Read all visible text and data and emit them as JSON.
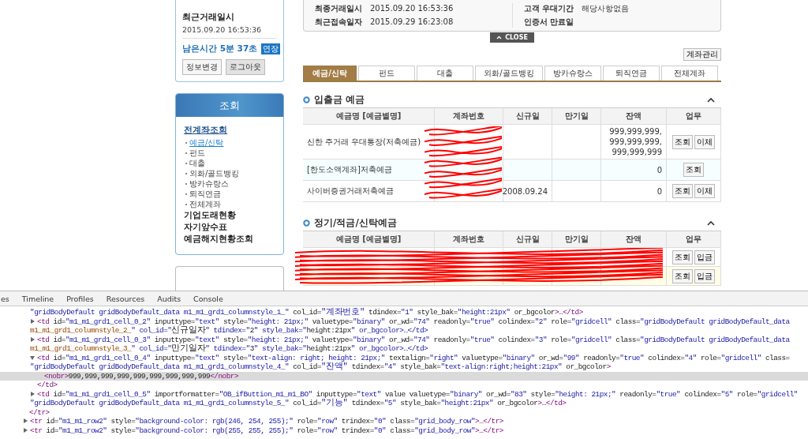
{
  "user_box": {
    "last_trade_label": "최근거래일시",
    "last_trade_value": "2015.09.20 16:53:36",
    "remaining": "남은시간 5분 37초",
    "extend_button": "연장",
    "buttons": [
      "정보변경",
      "로그아웃"
    ]
  },
  "menu": {
    "title": "조회",
    "items": [
      {
        "label": "전계좌조회",
        "kind": "group",
        "selected": true,
        "children": [
          {
            "label": "예금/신탁",
            "selected": true
          },
          {
            "label": "펀드",
            "selected": false
          },
          {
            "label": "대출",
            "selected": false
          },
          {
            "label": "외화/골드뱅킹",
            "selected": false
          },
          {
            "label": "방카슈랑스",
            "selected": false
          },
          {
            "label": "퇴직연금",
            "selected": false
          },
          {
            "label": "전체계좌",
            "selected": false
          }
        ]
      },
      {
        "label": "기업도래현황",
        "kind": "link",
        "selected": false
      },
      {
        "label": "자기앞수표",
        "kind": "link",
        "selected": false
      },
      {
        "label": "예금해지현황조회",
        "kind": "link",
        "selected": false
      }
    ]
  },
  "info_card": {
    "left": [
      {
        "label": "최종거래일시",
        "value": "2015.09.20 16:53:36"
      },
      {
        "label": "최근접속일자",
        "value": "2015.09.29 16:23:08"
      }
    ],
    "right": [
      {
        "label": "고객 우대기간",
        "value": "해당사항없음"
      },
      {
        "label": "인증서 만료일"
      }
    ],
    "close_button": "CLOSE"
  },
  "account_manage_button": "계좌관리",
  "tabs": [
    {
      "label": "예금/신탁",
      "selected": true
    },
    {
      "label": "펀드",
      "selected": false
    },
    {
      "label": "대출",
      "selected": false
    },
    {
      "label": "외화/골드뱅킹",
      "selected": false
    },
    {
      "label": "방카슈랑스",
      "selected": false
    },
    {
      "label": "퇴직연금",
      "selected": false
    },
    {
      "label": "전체계좌",
      "selected": false
    }
  ],
  "sections": [
    {
      "title": "입출금 예금",
      "expanded": true,
      "columns": [
        "예금명 [예금별명]",
        "계좌번호",
        "신규일",
        "만기일",
        "잔액",
        "업무"
      ],
      "rows": [
        {
          "name": "신한 주거래 우대통장(저축예금)",
          "balance": "999,999,999,999,999,999,999,999,999",
          "buttons": [
            "조회",
            "이체"
          ],
          "color": "#ffffff"
        },
        {
          "name": "[한도소액계좌]저축예금",
          "balance": "0",
          "buttons": [
            "조회"
          ],
          "color": "#f6feff"
        },
        {
          "name": "사이버증권거래저축예금",
          "opened": "2008.09.24",
          "balance": "0",
          "buttons": [
            "조회",
            "이체"
          ],
          "color": "#ffffff"
        }
      ]
    },
    {
      "title": "정기/적금/신탁예금",
      "expanded": true,
      "columns": [
        "예금명 [예금별명]",
        "계좌번호",
        "신규일",
        "만기일",
        "잔액",
        "업무"
      ],
      "rows": [
        {
          "buttons": [
            "조회",
            "입금"
          ],
          "color": "#ffffff"
        },
        {
          "buttons": [
            "조회",
            "입금"
          ],
          "color": "#fffde6"
        }
      ]
    }
  ],
  "devtools": {
    "tabs": [
      {
        "label": "es",
        "selected": false
      },
      {
        "label": "Timeline",
        "selected": false
      },
      {
        "label": "Profiles",
        "selected": false
      },
      {
        "label": "Resources",
        "selected": false
      },
      {
        "label": "Audits",
        "selected": false
      },
      {
        "label": "Console",
        "selected": false
      }
    ],
    "dom_tree": [
      {
        "expanded": true,
        "selected": false,
        "closing": "</tr>",
        "children": [
          {
            "continued": true,
            "selected": false,
            "lines": [
              "\"gridBodyDefault gridBodyDefault_data m1_m1_grd1_columnstyle_1_\" col_id=\"계좌번호\" tdindex=\"1\" style_bak=\"height:21px\" or_bgcolor>…</td>"
            ]
          },
          {
            "expanded": false,
            "selected": false,
            "lines": [
              "<td id=\"m1_m1_grd1_cell_0_2\" inputtype=\"text\" style=\"height: 21px;\" valuetype=\"binary\" or_wd=\"74\" readonly=\"true\" colindex=\"2\" role=\"gridcell\" class=\"gridBodyDefault gridBodyDefault_data",
              "m1_m1_grd1_columnstyle_2_\" col_id=\"신규일자\" tdindex=\"2\" style_bak=\"height:21px\" or_bgcolor>…</td>"
            ]
          },
          {
            "expanded": false,
            "selected": false,
            "lines": [
              "<td id=\"m1_m1_grd1_cell_0_3\" inputtype=\"text\" style=\"height: 21px;\" valuetype=\"binary\" or_wd=\"74\" readonly=\"true\" colindex=\"3\" role=\"gridcell\" class=\"gridBodyDefault gridBodyDefault_data",
              "m1_m1_grd1_columnstyle_3_\" col_id=\"만기일자\" tdindex=\"3\" style_bak=\"height:21px\" or_bgcolor>…</td>"
            ]
          },
          {
            "expanded": true,
            "selected": false,
            "closing": "</td>",
            "lines": [
              "<td id=\"m1_m1_grd1_cell_0_4\" inputtype=\"text\" style=\"text-align: right; height: 21px;\" textalign=\"right\" valuetype=\"binary\" or_wd=\"99\" readonly=\"true\" colindex=\"4\" role=\"gridcell\" class=",
              "\"gridBodyDefault gridBodyDefault_data m1_m1_grd1_columnstyle_4_\" col_id=\"잔액\" tdindex=\"4\" style_bak=\"text-align:right;height:21px\" or_bgcolor>"
            ],
            "children": [
              {
                "selected": true,
                "lines": [
                  "<nobr>999,999,999,999,999,999,999,999,999</nobr>"
                ]
              }
            ]
          },
          {
            "expanded": false,
            "selected": false,
            "lines": [
              "<td id=\"m1_m1_grd1_cell_0_5\" importformatter=\"OB_ifButtion_m1_m1_BO\" inputtype=\"text\" value valuetype=\"binary\" or_wd=\"83\" style=\"height: 21px;\" readonly=\"true\" colindex=\"5\" role=\"gridcell\"",
              "\"gridBodyDefault gridBodyDefault_data m1_m1_grd1_columnstyle_5_\" col_id=\"기능\" tdindex=\"5\" style_bak=\"height:21px\" or_bgcolor>…</td>"
            ]
          }
        ]
      },
      {
        "expanded": false,
        "selected": false,
        "lines": [
          "<tr id=\"m1_m1_row2\" style=\"background-color: rgb(246, 254, 255);\" role=\"row\" trindex=\"0\" class=\"grid_body_row\">…</tr>"
        ]
      },
      {
        "expanded": false,
        "selected": false,
        "lines": [
          "<tr id=\"m1_m1_row2\" style=\"background-color: rgb(255, 255, 255);\" role=\"row\" trindex=\"0\" class=\"grid_body_row\">…</tr>"
        ]
      }
    ]
  }
}
